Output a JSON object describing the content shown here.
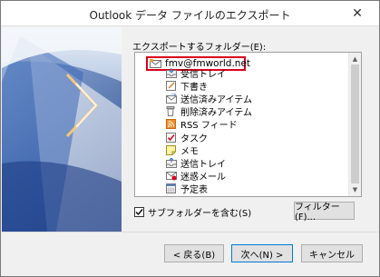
{
  "window": {
    "title": "Outlook データ ファイルのエクスポート",
    "close_glyph": "✕"
  },
  "folder_selector": {
    "label": "エクスポートするフォルダー(E):",
    "root": "fmv@fmworld.net",
    "items": [
      {
        "label": "受信トレイ",
        "icon": "inbox-icon"
      },
      {
        "label": "下書き",
        "icon": "drafts-icon"
      },
      {
        "label": "送信済みアイテム",
        "icon": "sent-items-icon"
      },
      {
        "label": "削除済みアイテム",
        "icon": "deleted-items-icon"
      },
      {
        "label": "RSS フィード",
        "icon": "rss-icon"
      },
      {
        "label": "タスク",
        "icon": "tasks-icon"
      },
      {
        "label": "メモ",
        "icon": "notes-icon"
      },
      {
        "label": "送信トレイ",
        "icon": "outbox-icon"
      },
      {
        "label": "迷惑メール",
        "icon": "junk-email-icon"
      },
      {
        "label": "予定表",
        "icon": "calendar-icon"
      }
    ]
  },
  "options": {
    "include_subfolders_label": "サブフォルダーを含む(S)",
    "include_subfolders_checked": true,
    "filter_button": "フィルター(F)..."
  },
  "footer": {
    "back": "< 戻る(B)",
    "next": "次へ(N) >",
    "cancel": "キャンセル"
  },
  "colors": {
    "highlight_border": "#d9001b",
    "banner_blue": "#2a5aa8"
  }
}
